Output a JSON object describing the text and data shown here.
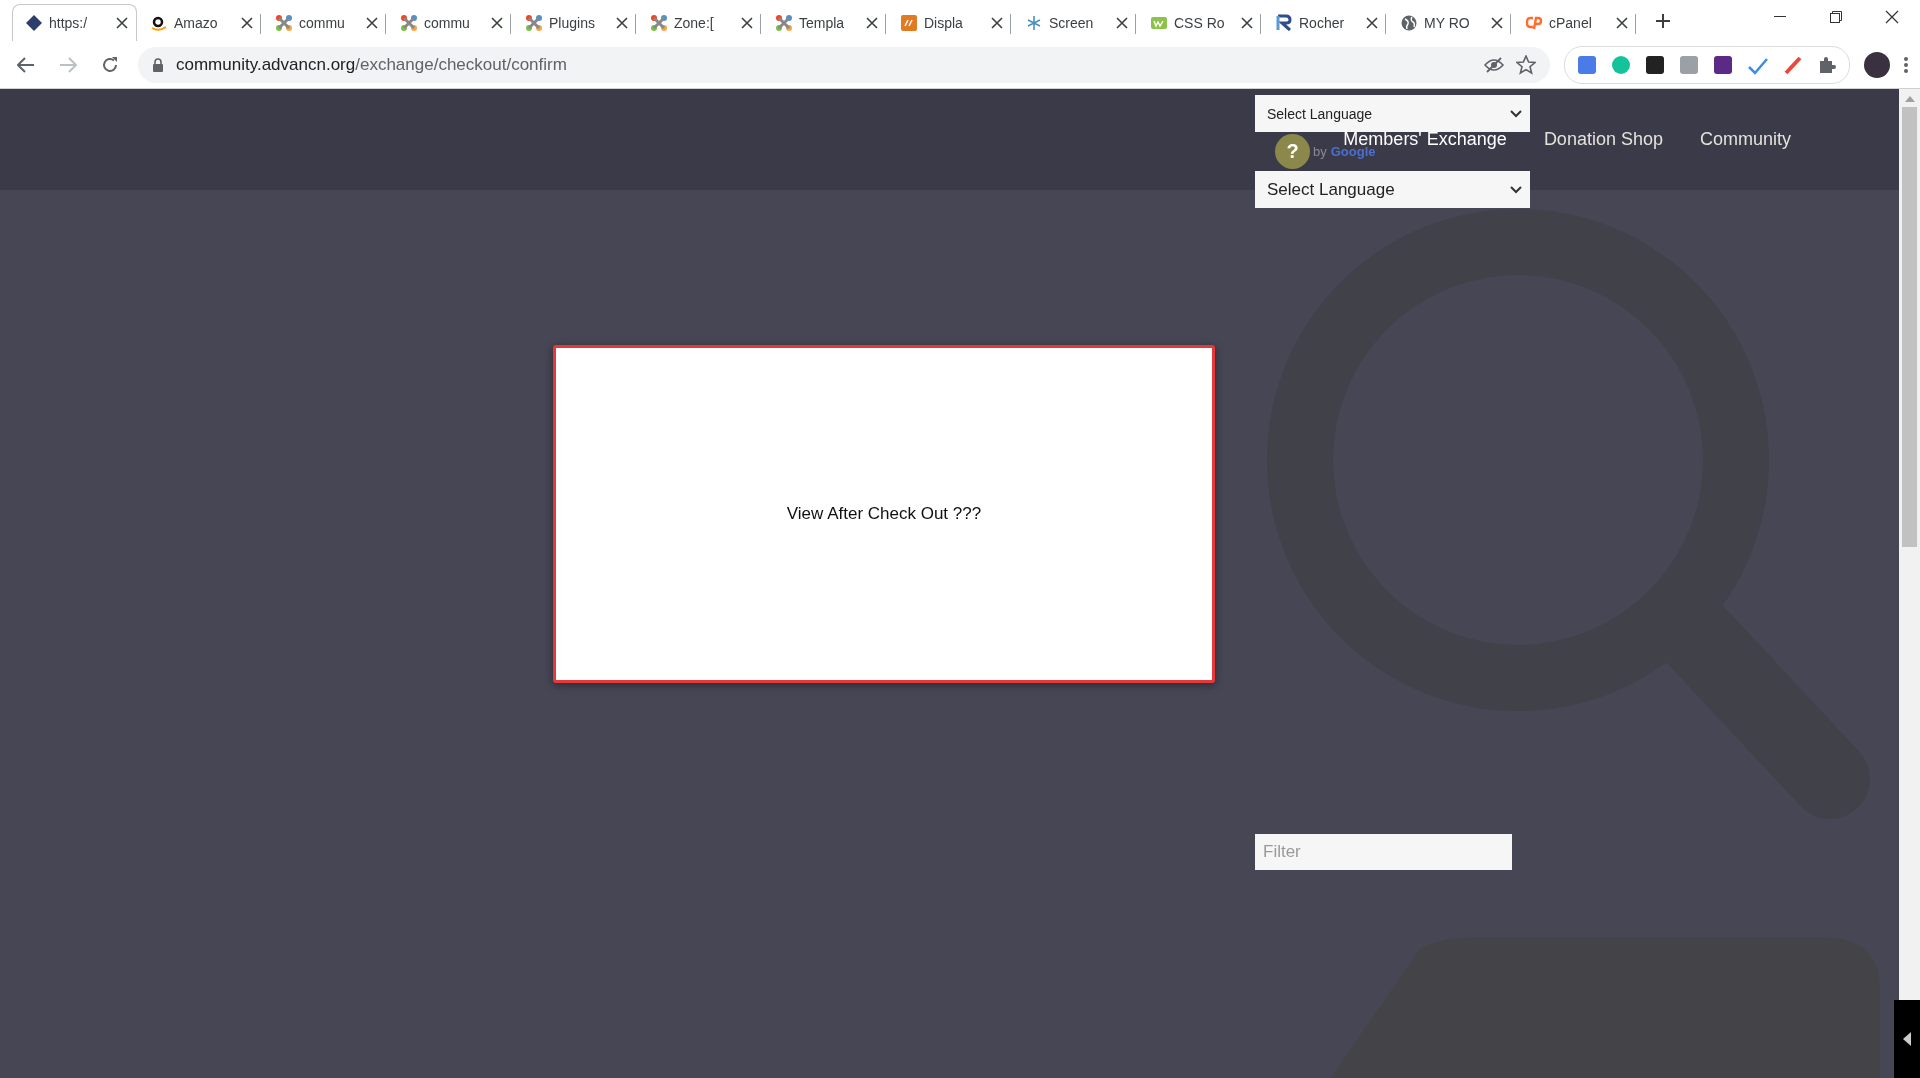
{
  "browser": {
    "tabs": [
      {
        "title": "https:/",
        "kind": "diamond",
        "selected": true
      },
      {
        "title": "Amazo",
        "kind": "amazon",
        "selected": false
      },
      {
        "title": "commu",
        "kind": "joomla",
        "selected": false
      },
      {
        "title": "commu",
        "kind": "joomla",
        "selected": false
      },
      {
        "title": "Plugins",
        "kind": "joomla",
        "selected": false
      },
      {
        "title": "Zone:[",
        "kind": "joomla",
        "selected": false
      },
      {
        "title": "Templa",
        "kind": "joomla",
        "selected": false
      },
      {
        "title": "Displa",
        "kind": "jm",
        "selected": false
      },
      {
        "title": "Screen",
        "kind": "asterisk",
        "selected": false
      },
      {
        "title": "CSS Ro",
        "kind": "w3",
        "selected": false
      },
      {
        "title": "Rocher",
        "kind": "r",
        "selected": false
      },
      {
        "title": "MY RO",
        "kind": "globe",
        "selected": false
      },
      {
        "title": "cPanel",
        "kind": "cpanel",
        "selected": false
      }
    ],
    "address": {
      "host": "community.advancn.org",
      "path": "/exchange/checkout/confirm"
    }
  },
  "translate": {
    "select_top": "Select Language",
    "help_mark": "?",
    "powered_by": "by",
    "google": "Google",
    "select_bottom": "Select Language"
  },
  "nav": [
    {
      "label": "Members' Exchange",
      "selected": true
    },
    {
      "label": "Donation Shop",
      "selected": false
    },
    {
      "label": "Community",
      "selected": false
    }
  ],
  "modal": {
    "text": "View After Check Out ???"
  },
  "filter": {
    "placeholder": "Filter"
  }
}
